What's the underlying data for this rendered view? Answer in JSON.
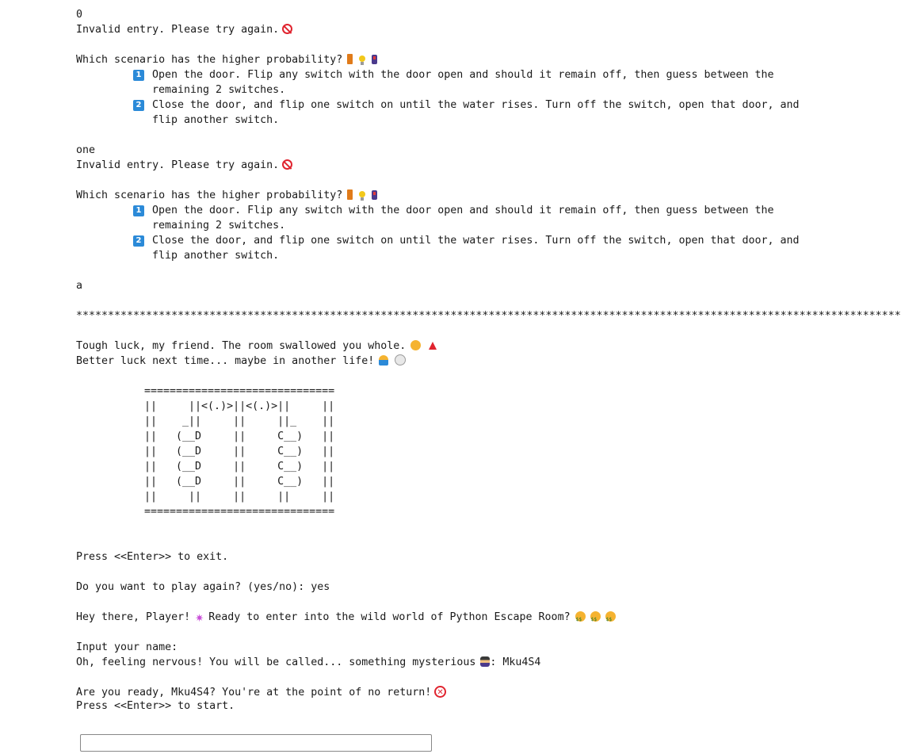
{
  "console": {
    "entry_1": "0",
    "invalid_1": "Invalid entry. Please try again.",
    "question_1": "Which scenario has the higher probability?",
    "option_1_num": "1",
    "option_1_text": "Open the door. Flip any switch with the door open and should it remain off, then guess between the remaining 2 switches.",
    "option_2_num": "2",
    "option_2_text": "Close the door, and flip one switch on until the water rises. Turn off the switch, open that door, and flip another switch.",
    "entry_2": "one",
    "invalid_2": "Invalid entry. Please try again.",
    "question_2": "Which scenario has the higher probability?",
    "entry_3": "a",
    "stars": "**************************************************************************************************************************************************************************************",
    "lose_line_1": "Tough luck, my friend. The room swallowed you whole.",
    "lose_line_2": "Better luck next time... maybe in another life!",
    "ascii_art": "==============================\n||     ||<(.)>||<(.)>||     ||\n||    _||     ||     ||_    ||\n||   (__D     ||     C__)   ||\n||   (__D     ||     C__)   ||\n||   (__D     ||     C__)   ||\n||   (__D     ||     C__)   ||\n||     ||     ||     ||     ||\n==============================",
    "press_exit": "Press <<Enter>> to exit.",
    "play_again": "Do you want to play again? (yes/no): yes",
    "greeting": "Hey there, Player!",
    "greeting_2": "Ready to enter into the wild world of Python Escape Room?",
    "input_name": "Input your name:",
    "nervous": "Oh, feeling nervous! You will be called... something mysterious",
    "name_value": ": Mku4S4",
    "ready": "Are you ready, Mku4S4? You're at the point of no return!",
    "press_start": "Press <<Enter>> to start."
  },
  "icons": {
    "prohibited": "prohibited-icon",
    "door": "door-icon",
    "bulb": "light-bulb-icon",
    "switch": "switch-icon",
    "dizzy_face": "dizzy-face-icon",
    "siren": "siren-icon",
    "shrug": "person-shrugging-icon",
    "skull": "skull-icon",
    "party": "party-popper-icon",
    "money_face": "money-mouth-face-icon",
    "detective": "detective-icon",
    "no_entry": "no-pedestrians-icon"
  },
  "colors": {
    "number_badge": "#2b8ad8",
    "prohibit_red": "#e0242f"
  }
}
